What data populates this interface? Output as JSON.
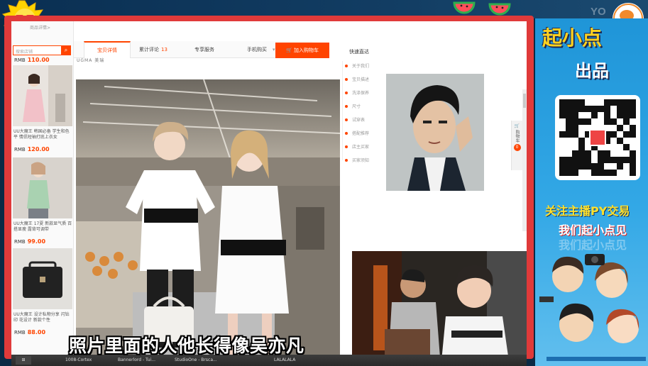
{
  "overlay": {
    "watermark": "YO",
    "promo_title": "起小点",
    "promo_sub": "出品",
    "promo_line1": "关注主播PY交易",
    "promo_line2": "我们起小点见",
    "promo_line2_ghost": "我们起小点见"
  },
  "subtitle": "照片里面的人他长得像吴亦凡",
  "sidebar": {
    "crumb": "商品详情>",
    "search_placeholder": "搜索店铺",
    "search_icon": "magnifier-icon",
    "items": [
      {
        "price_label": "RMB",
        "price": "110.00",
        "desc": ""
      },
      {
        "price_label": "RMB",
        "price": "120.00",
        "desc": "UU大魔王 韩国必备 学生和色平 情侣短袖打底上衣女"
      },
      {
        "price_label": "RMB",
        "price": "99.00",
        "desc": "UU大魔王 17夏 新款显气质 百搭显瘦 露背可调带"
      },
      {
        "price_label": "RMB",
        "price": "88.00",
        "desc": "UU大魔王 设计私物分享 闪钻印 花设计 新款个性"
      }
    ]
  },
  "tabs": [
    {
      "label": "宝贝详情",
      "active": true
    },
    {
      "label": "累计评论",
      "count": "13"
    },
    {
      "label": "专享服务"
    },
    {
      "label": "手机购买"
    }
  ],
  "cart_button": "加入购物车",
  "brand_strip": "UGMA 美瑞",
  "side_nav": {
    "title": "快速直达",
    "items": [
      "关于我们",
      "宝贝描述",
      "洗涤保养",
      "尺寸",
      "试穿表",
      "搭配推荐",
      "店主买家",
      "买家须知"
    ]
  },
  "cart_rail_label": "购物车",
  "cart_rail_count": "0",
  "taskbar": [
    "1008-Cortex",
    "Bannerlord - Tui...",
    "StudioOne - Brsca...",
    "LALALALA"
  ],
  "colors": {
    "accent": "#ff4400",
    "bezel": "#e03a3a",
    "promo_bg": "#2ea3e2"
  }
}
